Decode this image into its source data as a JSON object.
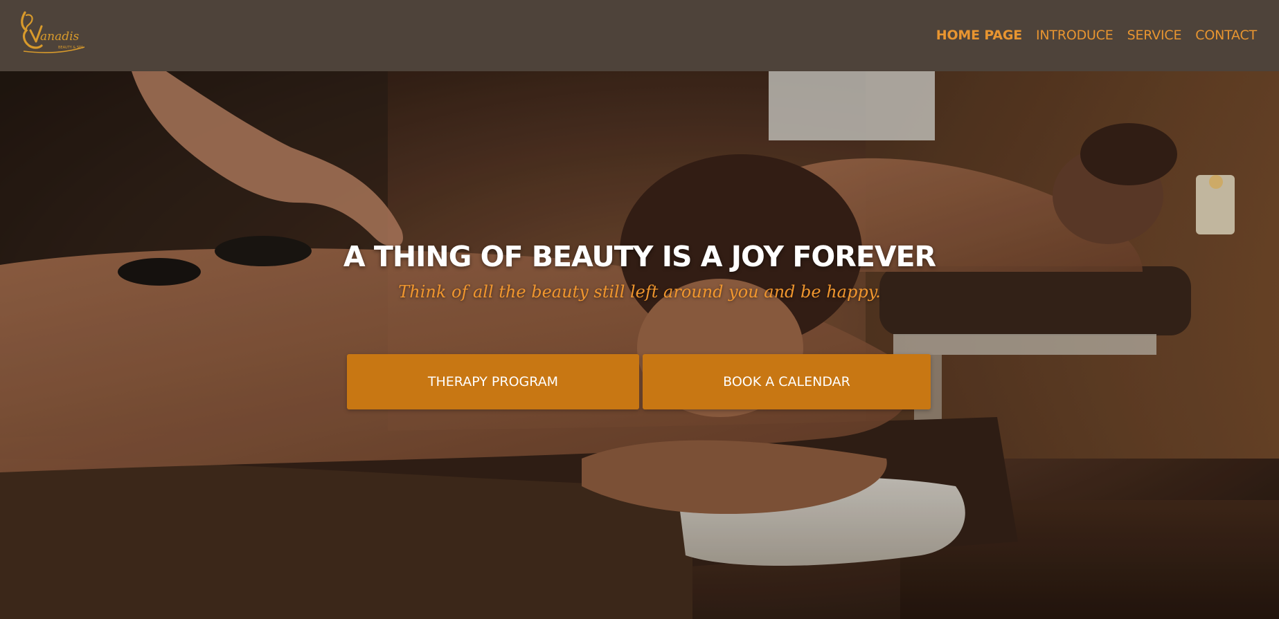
{
  "brand": {
    "logo_text": "Vanadis",
    "logo_tagline": "BEAUTY & SPA",
    "accent_color": "#e89530"
  },
  "nav": {
    "items": [
      {
        "label": "HOME PAGE",
        "active": true
      },
      {
        "label": "INTRODUCE",
        "active": false
      },
      {
        "label": "SERVICE",
        "active": false
      },
      {
        "label": "CONTACT",
        "active": false
      }
    ]
  },
  "hero": {
    "title": "A THING OF BEAUTY IS A JOY FOREVER",
    "subtitle": "Think of all the beauty still left around you and be happy.",
    "background_icon": "spa-massage-photo"
  },
  "buttons": {
    "therapy": "THERAPY PROGRAM",
    "book": "BOOK A CALENDAR",
    "color": "#c87713"
  }
}
